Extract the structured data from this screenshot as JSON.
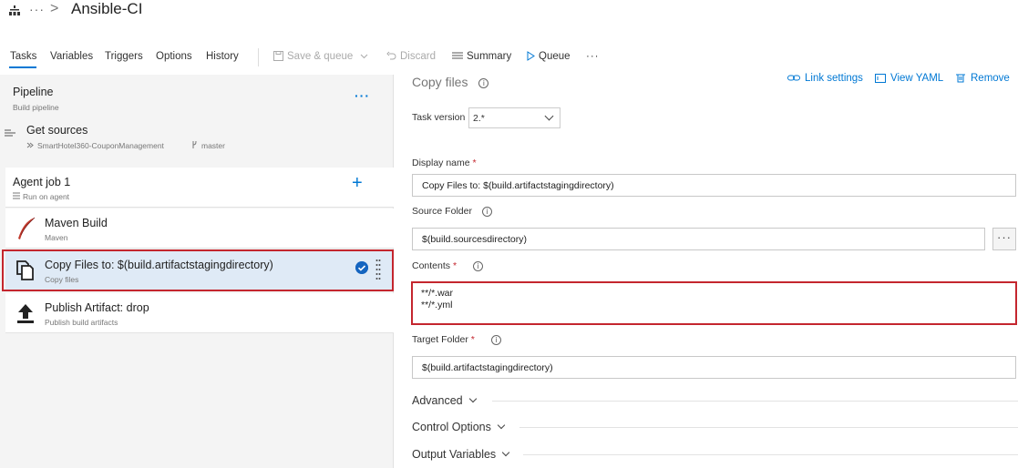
{
  "breadcrumb": {
    "more": "···",
    "separator": ">",
    "title": "Ansible-CI"
  },
  "toolbar": {
    "tabs": [
      "Tasks",
      "Variables",
      "Triggers",
      "Options",
      "History"
    ],
    "save_queue": "Save & queue",
    "discard": "Discard",
    "summary": "Summary",
    "queue": "Queue",
    "more": "···"
  },
  "pipeline": {
    "title": "Pipeline",
    "subtitle": "Build pipeline",
    "more": "···"
  },
  "get_sources": {
    "title": "Get sources",
    "repo": "SmartHotel360-CouponManagement",
    "branch": "master"
  },
  "agent_job": {
    "title": "Agent job 1",
    "subtitle": "Run on agent",
    "add": "+"
  },
  "tasks": [
    {
      "title": "Maven Build",
      "subtitle": "Maven"
    },
    {
      "title": "Copy Files to: $(build.artifactstagingdirectory)",
      "subtitle": "Copy files"
    },
    {
      "title": "Publish Artifact: drop",
      "subtitle": "Publish build artifacts"
    }
  ],
  "details": {
    "title": "Copy files",
    "link_settings": "Link settings",
    "view_yaml": "View YAML",
    "remove": "Remove",
    "task_version_label": "Task version",
    "task_version": "2.*",
    "display_name_label": "Display name",
    "display_name": "Copy Files to: $(build.artifactstagingdirectory)",
    "source_folder_label": "Source Folder",
    "source_folder": "$(build.sourcesdirectory)",
    "browse": "···",
    "contents_label": "Contents",
    "contents": "**/*.war\n**/*.yml",
    "target_folder_label": "Target Folder",
    "target_folder": "$(build.artifactstagingdirectory)",
    "required_mark": "*",
    "sections": [
      "Advanced",
      "Control Options",
      "Output Variables"
    ]
  },
  "colors": {
    "accent": "#0078d4",
    "highlight": "#c4262e",
    "selected_row": "#dfeaf6"
  }
}
